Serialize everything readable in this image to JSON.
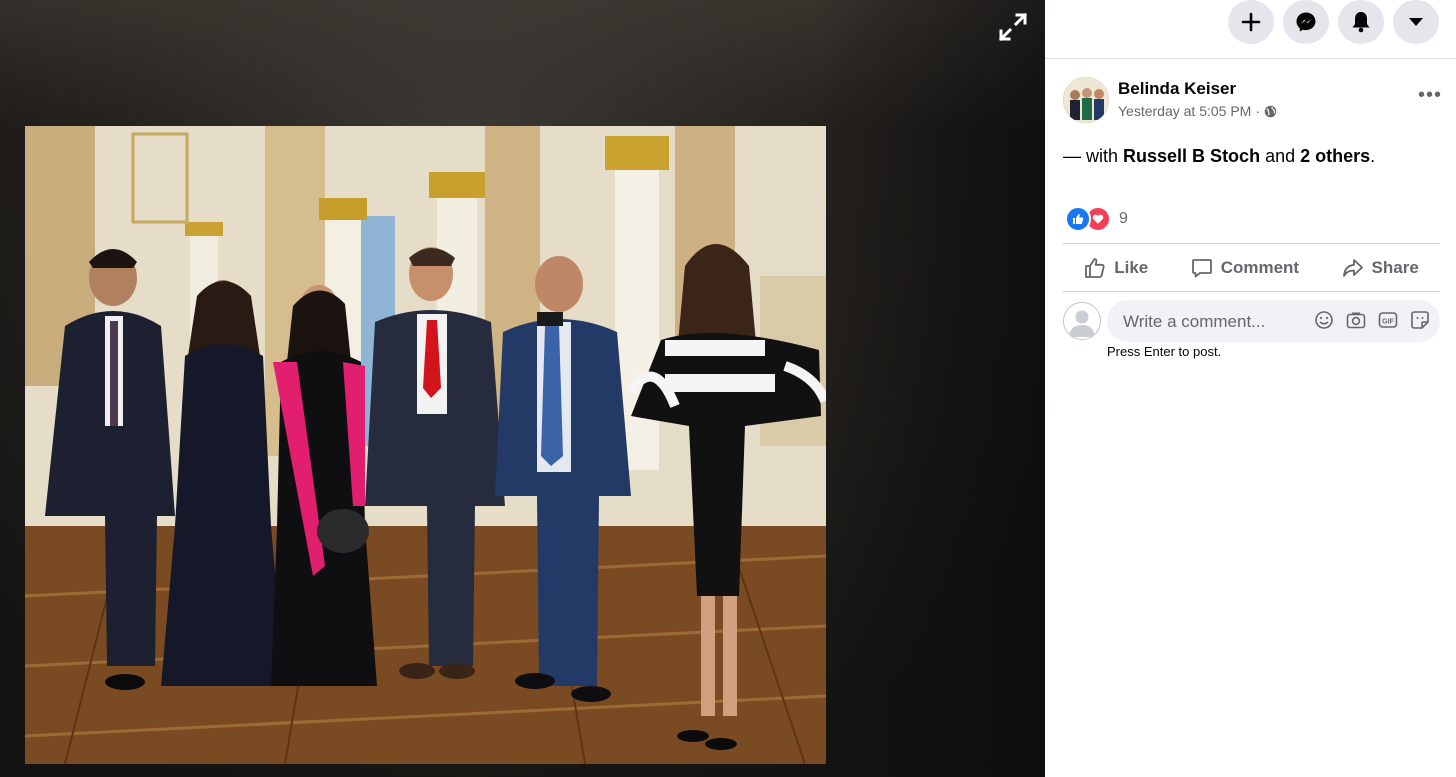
{
  "viewer": {
    "expand_icon": "expand-arrows-icon"
  },
  "topbar": {
    "icons": [
      "plus-icon",
      "messenger-icon",
      "bell-icon",
      "caret-down-icon"
    ]
  },
  "post": {
    "author": "Belinda Keiser",
    "timestamp": "Yesterday at 5:05 PM",
    "separator": "·",
    "privacy_icon": "globe-icon",
    "with_prefix": "— with",
    "tagged_person": "Russell B Stoch",
    "and_text": "and",
    "others": "2 others",
    "period": ".",
    "reaction_count": "9",
    "reaction_types": [
      "like",
      "love"
    ]
  },
  "actions": {
    "like": "Like",
    "comment": "Comment",
    "share": "Share"
  },
  "comment_box": {
    "placeholder": "Write a comment...",
    "hint": "Press Enter to post.",
    "icons": [
      "emoji-icon",
      "camera-icon",
      "gif-icon",
      "sticker-icon"
    ]
  },
  "colors": {
    "accent": "#1877f2",
    "love": "#f33e58",
    "secondary_text": "#65676b"
  }
}
